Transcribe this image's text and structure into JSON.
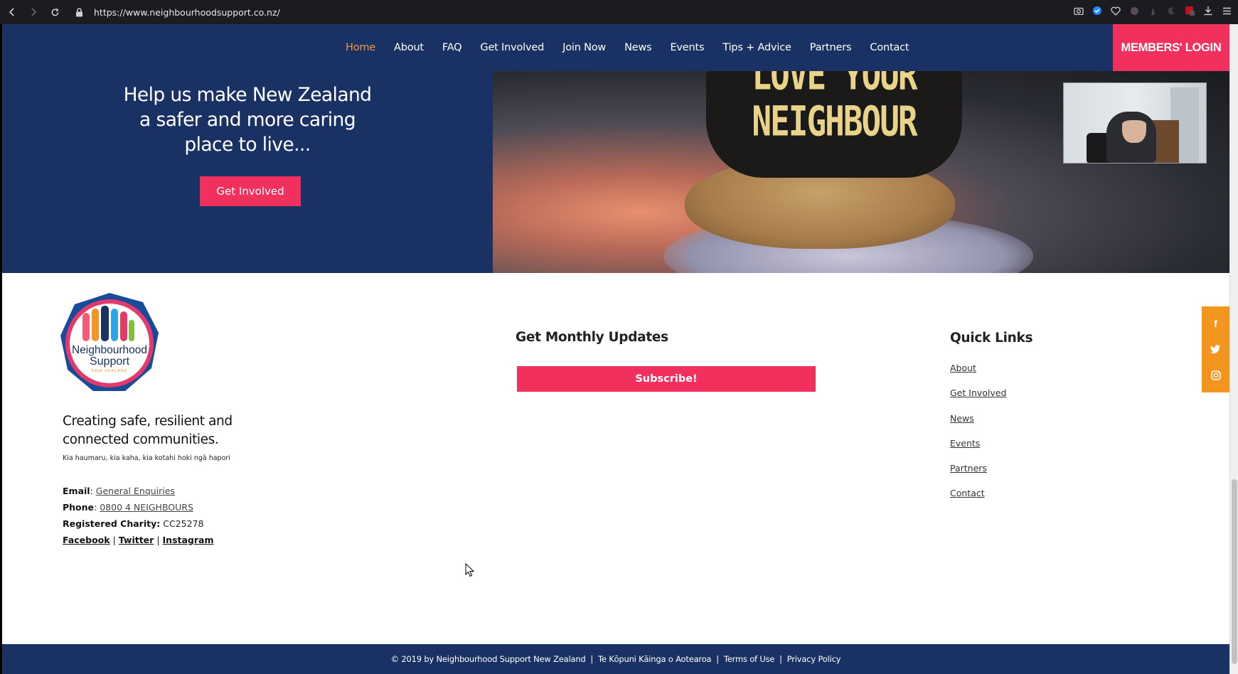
{
  "browser": {
    "url": "https://www.neighbourhoodsupport.co.nz/",
    "back_icon": "‹",
    "forward_icon": "›",
    "reload_icon": "↻"
  },
  "header": {
    "nav": [
      "Home",
      "About",
      "FAQ",
      "Get Involved",
      "Join Now",
      "News",
      "Events",
      "Tips + Advice",
      "Partners",
      "Contact"
    ],
    "active_nav": "Home",
    "login_label": "MEMBERS' LOGIN"
  },
  "hero": {
    "line1": "Help us make New Zealand",
    "line2": "a safer and more caring",
    "line3": "place to live...",
    "button_label": "Get Involved",
    "image_cap_line1": "LOVE YOUR",
    "image_cap_line2": "NEIGHBOUR"
  },
  "logo": {
    "line1": "Neighbourhood",
    "line2": "Support",
    "line3": "NEW ZEALAND"
  },
  "about": {
    "tagline_line1": "Creating safe, resilient and",
    "tagline_line2": "connected communities.",
    "tagline_sub": "Kia haumaru, kia kaha, kia kotahi hoki ngā hapori"
  },
  "contact": {
    "email_label": "Email",
    "email_value": "General Enquiries",
    "phone_label": "Phone",
    "phone_value": "0800 4 NEIGHBOURS",
    "charity_label": "Registered Charity:",
    "charity_value": "CC25278",
    "social": [
      "Facebook",
      "Twitter",
      "Instagram"
    ]
  },
  "updates": {
    "title": "Get Monthly Updates",
    "button_label": "Subscribe!"
  },
  "quick_links": {
    "title": "Quick Links",
    "items": [
      "About",
      "Get Involved",
      "News",
      "Events",
      "Partners",
      "Contact"
    ]
  },
  "social_bar": {
    "facebook": "f",
    "twitter": "t",
    "instagram": "◎"
  },
  "footer": {
    "copyright": "© 2019 by Neighbourhood Support New Zealand",
    "sep": "  |  ",
    "maori": "Te Kōpuni Kāinga o Aotearoa",
    "terms": "Terms of Use",
    "privacy": "Privacy Policy"
  },
  "colors": {
    "navy": "#1a3263",
    "pink": "#f2305e",
    "orange": "#f4951f",
    "active_nav": "#f29544"
  }
}
